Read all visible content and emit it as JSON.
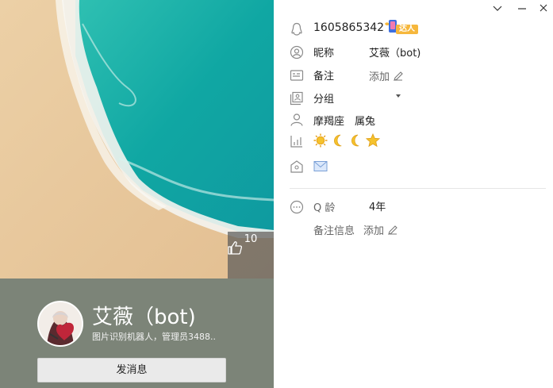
{
  "profile": {
    "likes": "10",
    "display_name": "艾薇（bot)",
    "signature": "图片识别机器人，管理员3488..",
    "send_button": "发消息"
  },
  "info": {
    "qq_number": "1605865342",
    "vip_badge_text": "达人",
    "nickname_label": "昵称",
    "nickname_value": "艾薇（bot)",
    "remark_label": "备注",
    "remark_add": "添加",
    "group_label": "分组",
    "zodiac": "摩羯座",
    "chinese_zodiac": "属兔",
    "level_icons": [
      "sun-icon",
      "moon-icon",
      "moon-icon",
      "star-icon"
    ],
    "qage_label": "Q 龄",
    "qage_value": "4年",
    "remark_info_label": "备注信息",
    "remark_info_add": "添加"
  },
  "colors": {
    "card_bottom": "#7c8478",
    "sea": "#1bb0a8",
    "sand": "#e6c79e"
  }
}
